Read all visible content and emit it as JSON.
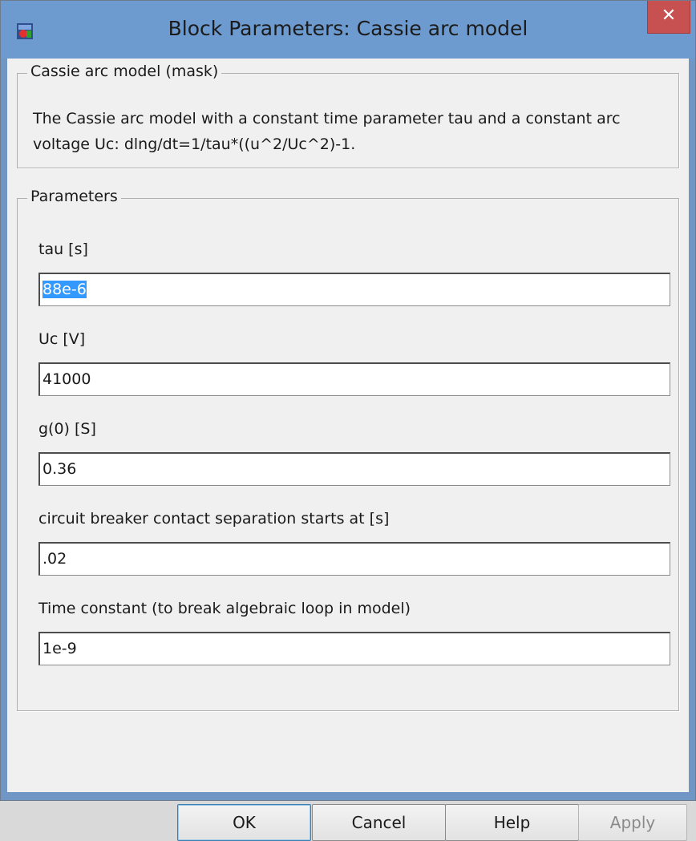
{
  "window": {
    "title": "Block Parameters: Cassie arc model",
    "close_glyph": "✕",
    "icon": "simulink-block-icon"
  },
  "mask": {
    "legend": "Cassie arc model (mask)",
    "description": "The Cassie arc model with a constant time parameter tau and a constant arc voltage Uc: dlng/dt=1/tau*((u^2/Uc^2)-1."
  },
  "parameters": {
    "legend": "Parameters",
    "fields": [
      {
        "label": "tau [s]",
        "value": "88e-6"
      },
      {
        "label": "Uc [V]",
        "value": "41000"
      },
      {
        "label": "g(0) [S]",
        "value": "0.36"
      },
      {
        "label": "circuit breaker contact separation starts at [s]",
        "value": ".02"
      },
      {
        "label": "Time constant (to break algebraic loop in model)",
        "value": "1e-9"
      }
    ]
  },
  "buttons": {
    "ok": "OK",
    "cancel": "Cancel",
    "help": "Help",
    "apply": "Apply"
  },
  "colors": {
    "titlebar": "#6d9bd0",
    "close": "#c75050",
    "selection": "#3399ff"
  }
}
